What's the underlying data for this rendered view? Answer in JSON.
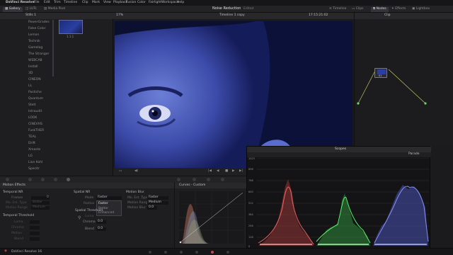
{
  "menubar": {
    "app": "DaVinci Resolve",
    "items": [
      "File",
      "Edit",
      "Trim",
      "Timeline",
      "Clip",
      "Mark",
      "View",
      "Playback",
      "Fusion",
      "Color",
      "Fairlight",
      "Workspace",
      "Help"
    ]
  },
  "toolbar": {
    "gallery": "Gallery",
    "luts": "LUTs",
    "media_pool": "Media Pool",
    "project_title": "Noise Reduction",
    "project_status": "Edited",
    "timeline": "Timeline",
    "clips": "Clips",
    "nodes": "Nodes",
    "effects": "Effects",
    "lightbox": "Lightbox"
  },
  "viewer_header": {
    "zoom": "17%",
    "timeline_name": "Timeline 1 copy",
    "timecode": "17:15:21:02",
    "clip_mode": "Clip"
  },
  "gallery": {
    "stills_title": "Stills 1",
    "still_label": "1.1.1",
    "albums": [
      "PowerGrades",
      "False Color",
      "Lemon",
      "Technik",
      "Gamelog",
      "The Stranger",
      "WEBCAB",
      "Install",
      "3D",
      "CINEON",
      "LL",
      "Pastiche",
      "Quantum",
      "Stelt",
      "Intraudit",
      "LOOK",
      "CINEVHS",
      "FuskTHER",
      "TEAL",
      "Drift",
      "Xmaste",
      "LG",
      "Lion Kohl",
      "Specitr"
    ]
  },
  "viewer_controls": {
    "icons": [
      "crop-icon",
      "play-reverse-icon",
      "stop-icon",
      "play-icon",
      "forward-icon",
      "loop-icon"
    ]
  },
  "motion_effects": {
    "title": "Motion Effects",
    "temporal_nr": {
      "title": "Temporal NR",
      "frames_label": "Frames",
      "frames_value": "0",
      "mo_est_type_label": "Mo. Est. Type",
      "mo_est_type_value": "Better",
      "motion_range_label": "Motion Range",
      "motion_range_value": "Medium"
    },
    "temporal_threshold": {
      "title": "Temporal Threshold",
      "luma_label": "Luma",
      "chroma_label": "Chroma",
      "motion_label": "Motion",
      "blend_label": "Blend"
    },
    "spatial_nr": {
      "title": "Spatial NR",
      "mode_label": "Mode",
      "mode_value": "Faster",
      "radius_label": "Radius",
      "dropdown_options": [
        "Faster",
        "Better",
        "Enhanced"
      ],
      "threshold_title": "Spatial Threshold",
      "luma_label": "Luma",
      "chroma_label": "Chroma",
      "chroma_value": "0.0",
      "blend_label": "Blend",
      "blend_value": "0.0"
    },
    "motion_blur": {
      "title": "Motion Blur",
      "mo_est_type_label": "Mo. Est. Type",
      "mo_est_type_value": "Faster",
      "motion_range_label": "Motion Range",
      "motion_range_value": "Medium",
      "motion_blur_label": "Motion Blur",
      "motion_blur_value": "0.0"
    }
  },
  "curves": {
    "title": "Curves - Custom"
  },
  "scopes": {
    "title": "Scopes",
    "mode": "Parade",
    "scale": [
      "1023",
      "896",
      "768",
      "640",
      "512",
      "384",
      "256",
      "128",
      "0"
    ],
    "colors": {
      "red": "#e04848",
      "green": "#3fcf4f",
      "blue": "#5a66ee"
    }
  },
  "nodes": {
    "node_label": "01"
  },
  "statusbar": {
    "app_version": "DaVinci Resolve 16"
  }
}
